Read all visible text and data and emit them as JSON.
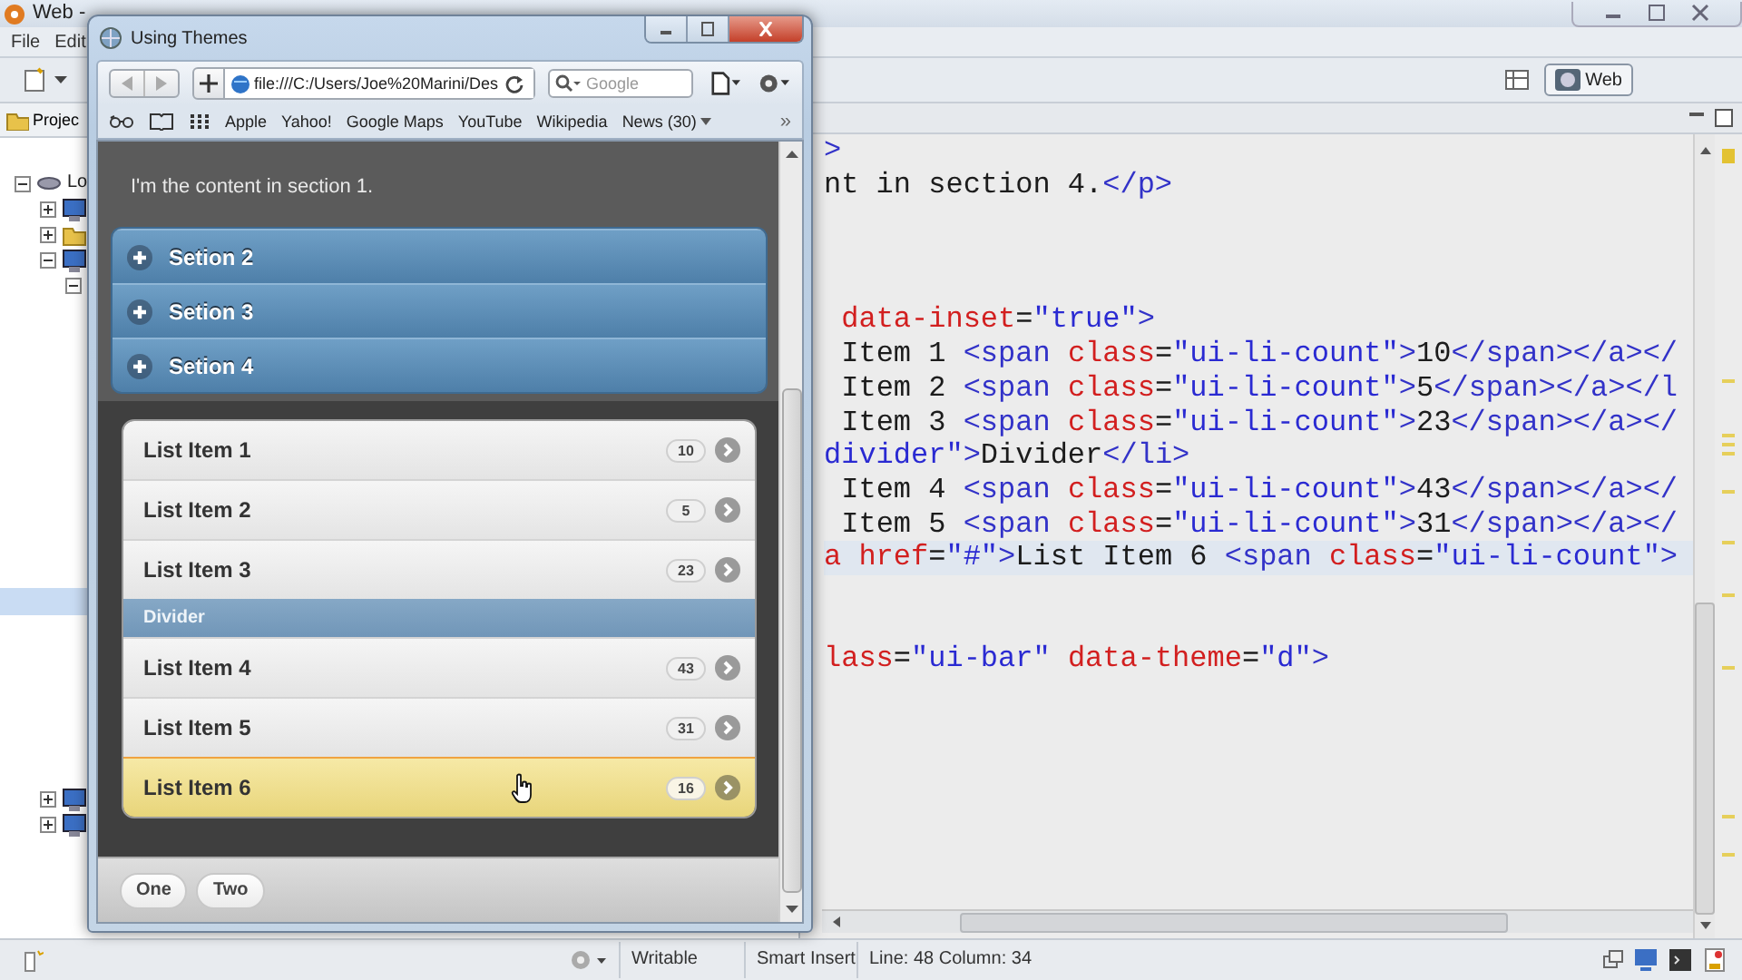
{
  "ide": {
    "title": "Web -",
    "menu": [
      "File",
      "Edit"
    ],
    "perspective": {
      "label": "Web",
      "selected": true
    },
    "project_tab": "Projec",
    "tree": [
      {
        "label": "Lo",
        "expanded": true,
        "children": [
          {
            "expanded": false,
            "kind": "monitor"
          },
          {
            "expanded": false,
            "kind": "folder"
          },
          {
            "expanded": true,
            "kind": "monitor",
            "children": [
              {
                "expanded": true
              }
            ]
          }
        ]
      }
    ],
    "selected_row": {
      "selected": true
    },
    "tree_lower": [
      {
        "expanded": false,
        "kind": "monitor"
      },
      {
        "expanded": false,
        "kind": "monitor"
      }
    ],
    "code": [
      {
        "current": false,
        "tokens": [
          {
            "kind": "tag",
            "text": ">"
          }
        ]
      },
      {
        "current": false,
        "tokens": [
          {
            "kind": "text",
            "text": "nt in section 4."
          },
          {
            "kind": "tag",
            "text": "</p>"
          }
        ]
      },
      {
        "current": false
      },
      {
        "current": false
      },
      {
        "current": false
      },
      {
        "current": false,
        "tokens": [
          {
            "kind": "attr",
            "text": " data-inset"
          },
          {
            "kind": "text",
            "text": "="
          },
          {
            "kind": "value",
            "text": "\"true\""
          },
          {
            "kind": "tag",
            "text": ">"
          }
        ]
      },
      {
        "current": false,
        "tokens": [
          {
            "kind": "text",
            "text": " Item 1 "
          },
          {
            "kind": "tag",
            "text": "<span "
          },
          {
            "kind": "attr",
            "text": "class"
          },
          {
            "kind": "text",
            "text": "="
          },
          {
            "kind": "value",
            "text": "\"ui-li-count\""
          },
          {
            "kind": "tag",
            "text": ">"
          },
          {
            "kind": "text",
            "text": "10"
          },
          {
            "kind": "tag",
            "text": "</span></a></"
          }
        ]
      },
      {
        "current": false,
        "tokens": [
          {
            "kind": "text",
            "text": " Item 2 "
          },
          {
            "kind": "tag",
            "text": "<span "
          },
          {
            "kind": "attr",
            "text": "class"
          },
          {
            "kind": "text",
            "text": "="
          },
          {
            "kind": "value",
            "text": "\"ui-li-count\""
          },
          {
            "kind": "tag",
            "text": ">"
          },
          {
            "kind": "text",
            "text": "5"
          },
          {
            "kind": "tag",
            "text": "</span></a></l"
          }
        ]
      },
      {
        "current": false,
        "tokens": [
          {
            "kind": "text",
            "text": " Item 3 "
          },
          {
            "kind": "tag",
            "text": "<span "
          },
          {
            "kind": "attr",
            "text": "class"
          },
          {
            "kind": "text",
            "text": "="
          },
          {
            "kind": "value",
            "text": "\"ui-li-count\""
          },
          {
            "kind": "tag",
            "text": ">"
          },
          {
            "kind": "text",
            "text": "23"
          },
          {
            "kind": "tag",
            "text": "</span></a></"
          }
        ]
      },
      {
        "current": false,
        "tokens": [
          {
            "kind": "value",
            "text": "divider\""
          },
          {
            "kind": "tag",
            "text": ">"
          },
          {
            "kind": "text",
            "text": "Divider"
          },
          {
            "kind": "tag",
            "text": "</li>"
          }
        ]
      },
      {
        "current": false,
        "tokens": [
          {
            "kind": "text",
            "text": " Item 4 "
          },
          {
            "kind": "tag",
            "text": "<span "
          },
          {
            "kind": "attr",
            "text": "class"
          },
          {
            "kind": "text",
            "text": "="
          },
          {
            "kind": "value",
            "text": "\"ui-li-count\""
          },
          {
            "kind": "tag",
            "text": ">"
          },
          {
            "kind": "text",
            "text": "43"
          },
          {
            "kind": "tag",
            "text": "</span></a></"
          }
        ]
      },
      {
        "current": false,
        "tokens": [
          {
            "kind": "text",
            "text": " Item 5 "
          },
          {
            "kind": "tag",
            "text": "<span "
          },
          {
            "kind": "attr",
            "text": "class"
          },
          {
            "kind": "text",
            "text": "="
          },
          {
            "kind": "value",
            "text": "\"ui-li-count\""
          },
          {
            "kind": "tag",
            "text": ">"
          },
          {
            "kind": "text",
            "text": "31"
          },
          {
            "kind": "tag",
            "text": "</span></a></"
          }
        ]
      },
      {
        "current": true,
        "tokens": [
          {
            "kind": "attr",
            "text": "a href"
          },
          {
            "kind": "text",
            "text": "="
          },
          {
            "kind": "value",
            "text": "\"#\""
          },
          {
            "kind": "tag",
            "text": ">"
          },
          {
            "kind": "text",
            "text": "List Item 6 "
          },
          {
            "kind": "tag",
            "text": "<span "
          },
          {
            "kind": "attr",
            "text": "class"
          },
          {
            "kind": "text",
            "text": "="
          },
          {
            "kind": "value",
            "text": "\"ui-li-count\""
          },
          {
            "kind": "tag",
            "text": ">"
          }
        ]
      },
      {
        "current": false
      },
      {
        "current": false
      },
      {
        "current": false,
        "tokens": [
          {
            "kind": "attr",
            "text": "lass"
          },
          {
            "kind": "text",
            "text": "="
          },
          {
            "kind": "value",
            "text": "\"ui-bar\""
          },
          {
            "kind": "attr",
            "text": " data-theme"
          },
          {
            "kind": "text",
            "text": "="
          },
          {
            "kind": "value",
            "text": "\"d\""
          },
          {
            "kind": "tag",
            "text": ">"
          }
        ]
      }
    ],
    "status_bar": {
      "mode": "Writable",
      "insert": "Smart Insert",
      "position": "Line: 48 Column: 34"
    }
  },
  "browser": {
    "title": "Using Themes",
    "address": "file:///C:/Users/Joe%20Marini/Des",
    "search": {
      "placeholder": "Google"
    },
    "bookmarks": [
      {
        "label": "Apple",
        "kind": "link"
      },
      {
        "label": "Yahoo!",
        "kind": "link"
      },
      {
        "label": "Google Maps",
        "kind": "link"
      },
      {
        "label": "YouTube",
        "kind": "link"
      },
      {
        "label": "Wikipedia",
        "kind": "link"
      },
      {
        "label": "News (30)",
        "kind": "menu"
      }
    ],
    "more": "»",
    "page": {
      "section_text": "I'm the content in section 1.",
      "sections": [
        {
          "title": "Setion 2",
          "expanded": false
        },
        {
          "title": "Setion 3",
          "expanded": false
        },
        {
          "title": "Setion 4",
          "expanded": false
        }
      ],
      "list": [
        {
          "kind": "item",
          "label": "List Item 1",
          "count": "10",
          "selected": false
        },
        {
          "kind": "item",
          "label": "List Item 2",
          "count": "5",
          "selected": false
        },
        {
          "kind": "item",
          "label": "List Item 3",
          "count": "23",
          "selected": false
        },
        {
          "kind": "divider",
          "label": "Divider"
        },
        {
          "kind": "item",
          "label": "List Item 4",
          "count": "43",
          "selected": false
        },
        {
          "kind": "item",
          "label": "List Item 5",
          "count": "31",
          "selected": false
        },
        {
          "kind": "item",
          "label": "List Item 6",
          "count": "16",
          "selected": true
        }
      ],
      "footer_buttons": [
        "One",
        "Two"
      ]
    }
  }
}
